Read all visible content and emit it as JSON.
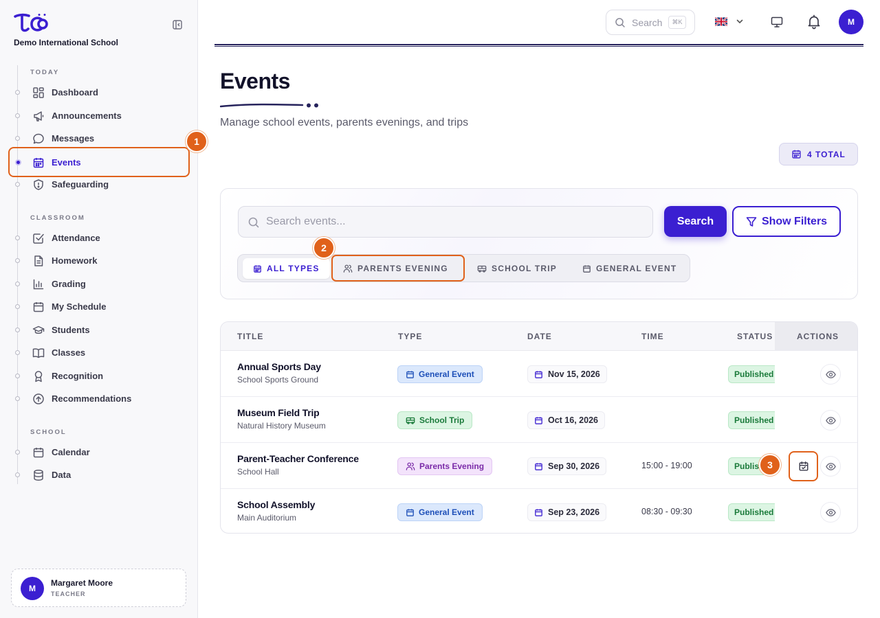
{
  "brand": {
    "school_name": "Demo International School"
  },
  "sidebar": {
    "sections": [
      {
        "label": "TODAY"
      },
      {
        "label": "CLASSROOM"
      },
      {
        "label": "SCHOOL"
      }
    ],
    "items": [
      {
        "label": "Dashboard",
        "icon": "dashboard-icon"
      },
      {
        "label": "Announcements",
        "icon": "megaphone-icon"
      },
      {
        "label": "Messages",
        "icon": "chat-bubble-icon"
      },
      {
        "label": "Events",
        "icon": "calendar-icon",
        "active": true
      },
      {
        "label": "Safeguarding",
        "icon": "shield-icon"
      },
      {
        "label": "Attendance",
        "icon": "checkbox-icon"
      },
      {
        "label": "Homework",
        "icon": "document-icon"
      },
      {
        "label": "Grading",
        "icon": "bar-chart-icon"
      },
      {
        "label": "My Schedule",
        "icon": "calendar-icon"
      },
      {
        "label": "Students",
        "icon": "graduation-cap-icon"
      },
      {
        "label": "Classes",
        "icon": "book-icon"
      },
      {
        "label": "Recognition",
        "icon": "award-icon"
      },
      {
        "label": "Recommendations",
        "icon": "arrow-up-circle-icon"
      },
      {
        "label": "Calendar",
        "icon": "calendar-icon"
      },
      {
        "label": "Data",
        "icon": "database-icon"
      }
    ]
  },
  "user": {
    "name": "Margaret Moore",
    "role": "TEACHER",
    "initial": "M"
  },
  "topbar": {
    "search_placeholder": "Search",
    "shortcut": "⌘K",
    "avatar_initial": "M",
    "language": "English (UK)"
  },
  "annotations": {
    "one": "1",
    "two": "2",
    "three": "3"
  },
  "page": {
    "title": "Events",
    "subtitle": "Manage school events, parents evenings, and trips",
    "total_badge": "4 TOTAL"
  },
  "filters": {
    "search_placeholder": "Search events...",
    "search_button": "Search",
    "show_filters_button": "Show Filters",
    "type_tabs": [
      {
        "label": "ALL TYPES",
        "active": true
      },
      {
        "label": "PARENTS EVENING"
      },
      {
        "label": "SCHOOL TRIP"
      },
      {
        "label": "GENERAL EVENT"
      }
    ]
  },
  "table": {
    "columns": [
      "TITLE",
      "TYPE",
      "DATE",
      "TIME",
      "STATUS",
      "ACTIONS"
    ],
    "rows": [
      {
        "title": "Annual Sports Day",
        "location": "School Sports Ground",
        "type": "General Event",
        "date": "Nov 15, 2026",
        "time": "",
        "status": "Published"
      },
      {
        "title": "Museum Field Trip",
        "location": "Natural History Museum",
        "type": "School Trip",
        "date": "Oct 16, 2026",
        "time": "",
        "status": "Published"
      },
      {
        "title": "Parent-Teacher Conference",
        "location": "School Hall",
        "type": "Parents Evening",
        "date": "Sep 30, 2026",
        "time": "15:00 - 19:00",
        "status": "Publis"
      },
      {
        "title": "School Assembly",
        "location": "Main Auditorium",
        "type": "General Event",
        "date": "Sep 23, 2026",
        "time": "08:30 - 09:30",
        "status": "Published"
      }
    ]
  },
  "colors": {
    "accent": "#3b1fd1",
    "highlight": "#e0611a",
    "general_event_bg": "#dbe8fc",
    "school_trip_bg": "#dcf5e3",
    "parents_evening_bg": "#f3e3fb",
    "published_bg": "#dcf5e3"
  }
}
